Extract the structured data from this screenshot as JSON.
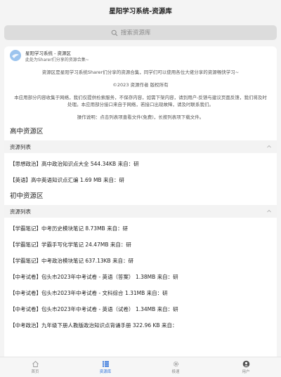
{
  "app": {
    "title": "星阳学习系统-资源库"
  },
  "search": {
    "placeholder": "搜索资源库"
  },
  "card": {
    "name": "星阳学习系统 - 资源区",
    "desc": "此处为Sharer们分享的资源合集~"
  },
  "intro": {
    "p1": "资源区是星阳学习系统Sharer们分享的资源合集，同学们可以使用各位大佬分享的资源畅快学习~",
    "p2": "©2023 资源作者 版权所有",
    "p3": "本应用部分内容收集于网络，我们仅提供检索服务，不保存内容，如需下架内容，请到用户-反馈与建议页面反馈，我们将及时处理。本应用部分接口来自于网络，若接口出现故障，请及时联系我们。",
    "p4": "操作说明：点击列表项查看文件(免费)，长按列表项下载文件。"
  },
  "sections": [
    {
      "title": "高中资源区",
      "list_header": "资源列表",
      "items": [
        "【思想政治】高中政治知识点大全 544.34KB 来自：研",
        "【英语】高中英语知识点汇编 1.69 MB 来自：研"
      ]
    },
    {
      "title": "初中资源区",
      "list_header": "资源列表",
      "items": [
        "【学霸笔记】中考历史模块笔记 8.73MB 来自：研",
        "【学霸笔记】学霸手写化学笔记 24.47MB 来自：研",
        "【学霸笔记】中考政治模块笔记 637.13KB 来自：研",
        "【中考试卷】包头市2023年中考试卷 - 英语（答案） 1.38MB 来自：研",
        "【中考试卷】包头市2023年中考试卷 - 文科综合 1.31MB 来自：研",
        "【中考试卷】包头市2023年中考试卷 - 英语（试卷） 1.34MB 来自：研",
        "【中考政治】九年级下册人教版政治知识点背诵手册 322.96 KB 来自："
      ]
    }
  ],
  "tabs": [
    {
      "label": "首页",
      "icon": "home-icon"
    },
    {
      "label": "资源库",
      "icon": "list-icon"
    },
    {
      "label": "极速",
      "icon": "gear-icon"
    },
    {
      "label": "用户",
      "icon": "user-icon"
    }
  ],
  "colors": {
    "accent": "#2a6fdb",
    "background": "#f4f4f4"
  }
}
